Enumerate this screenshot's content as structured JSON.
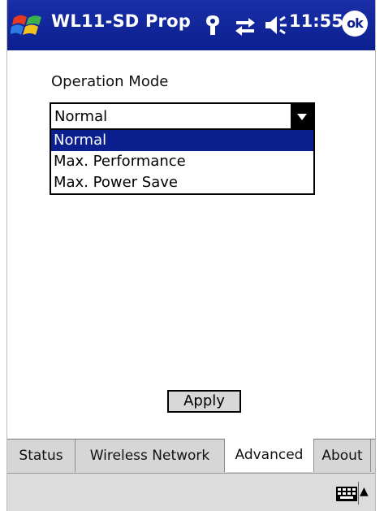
{
  "window": {
    "title": "WL11-SD Prop",
    "clock": "11:55",
    "ok_label": "ok"
  },
  "icons": {
    "start": "windows-flag-icon",
    "antenna": "antenna-icon",
    "connectivity": "connectivity-icon",
    "speaker": "speaker-icon",
    "keyboard": "keyboard-icon"
  },
  "form": {
    "operation_mode_label": "Operation Mode",
    "selected_value": "Normal",
    "options": [
      {
        "label": "Normal",
        "selected": true
      },
      {
        "label": "Max. Performance",
        "selected": false
      },
      {
        "label": "Max. Power Save",
        "selected": false
      }
    ],
    "apply_label": "Apply"
  },
  "tabs": [
    {
      "label": "Status",
      "active": false
    },
    {
      "label": "Wireless Network",
      "active": false
    },
    {
      "label": "Advanced",
      "active": true
    },
    {
      "label": "About",
      "active": false
    }
  ],
  "menubar": {
    "arrow": "▲"
  },
  "colors": {
    "titlebar": "#0b1f8f",
    "selection": "#0b1f8f"
  }
}
